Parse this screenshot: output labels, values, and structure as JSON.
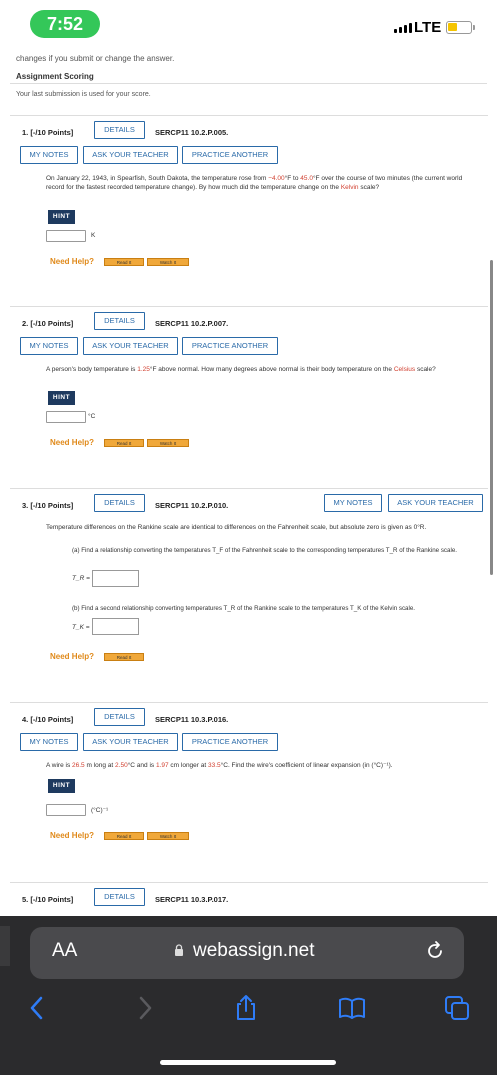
{
  "status": {
    "time": "7:52",
    "network": "LTE"
  },
  "page": {
    "cut_text": "changes if you submit or change the answer.",
    "scoring_title": "Assignment Scoring",
    "scoring_text": "Your last submission is used for your score."
  },
  "buttons": {
    "details": "DETAILS",
    "my_notes": "MY NOTES",
    "ask_teacher": "ASK YOUR TEACHER",
    "practice": "PRACTICE ANOTHER",
    "hint": "HINT",
    "need_help": "Need Help?",
    "read_it": "Read It",
    "watch_it": "Watch It"
  },
  "questions": [
    {
      "head": "1. [-/10 Points]",
      "code": "SERCP11 10.2.P.005.",
      "text_a": "On January 22, 1943, in Spearfish, South Dakota, the temperature rose from ",
      "v1": "−4.00",
      "text_b": "°F to ",
      "v2": "45.0",
      "text_c": "°F over the course of two minutes (the current world record for the fastest recorded temperature change). By how much did the temperature change on the ",
      "kw": "Kelvin",
      "text_d": " scale?",
      "unit": "K"
    },
    {
      "head": "2. [-/10 Points]",
      "code": "SERCP11 10.2.P.007.",
      "text_a": "A person's body temperature is ",
      "v1": "1.25",
      "text_b": "°F above normal. How many degrees above normal is their body temperature on the ",
      "kw": "Celsius",
      "text_c": " scale?",
      "unit": "°C"
    },
    {
      "head": "3. [-/10 Points]",
      "code": "SERCP11 10.2.P.010.",
      "text": "Temperature differences on the Rankine scale are identical to differences on the Fahrenheit scale, but absolute zero is given as 0°R.",
      "part_a": "(a) Find a relationship converting the temperatures T_F of the Fahrenheit scale to the corresponding temperatures T_R of the Rankine scale.",
      "part_a_label": "T_R =",
      "part_b": "(b) Find a second relationship converting temperatures T_R of the Rankine scale to the temperatures T_K of the Kelvin scale.",
      "part_b_label": "T_K ="
    },
    {
      "head": "4. [-/10 Points]",
      "code": "SERCP11 10.3.P.016.",
      "text_a": "A wire is ",
      "v1": "26.5",
      "text_b": " m long at ",
      "v2": "2.50",
      "text_c": "°C and is ",
      "v3": "1.97",
      "text_d": " cm longer at ",
      "v4": "33.5",
      "text_e": "°C. Find the wire's coefficient of linear expansion (in (°C)⁻¹).",
      "unit": "(°C)⁻¹"
    },
    {
      "head": "5. [-/10 Points]",
      "code": "SERCP11 10.3.P.017."
    }
  ],
  "safari": {
    "text_size": "AA",
    "url": "webassign.net"
  },
  "colors": {
    "accent": "#2a6aa8",
    "highlight": "#d13f2f",
    "help": "#e08a1b",
    "hint_bg": "#1e3a5f",
    "status_pill": "#34c759"
  }
}
